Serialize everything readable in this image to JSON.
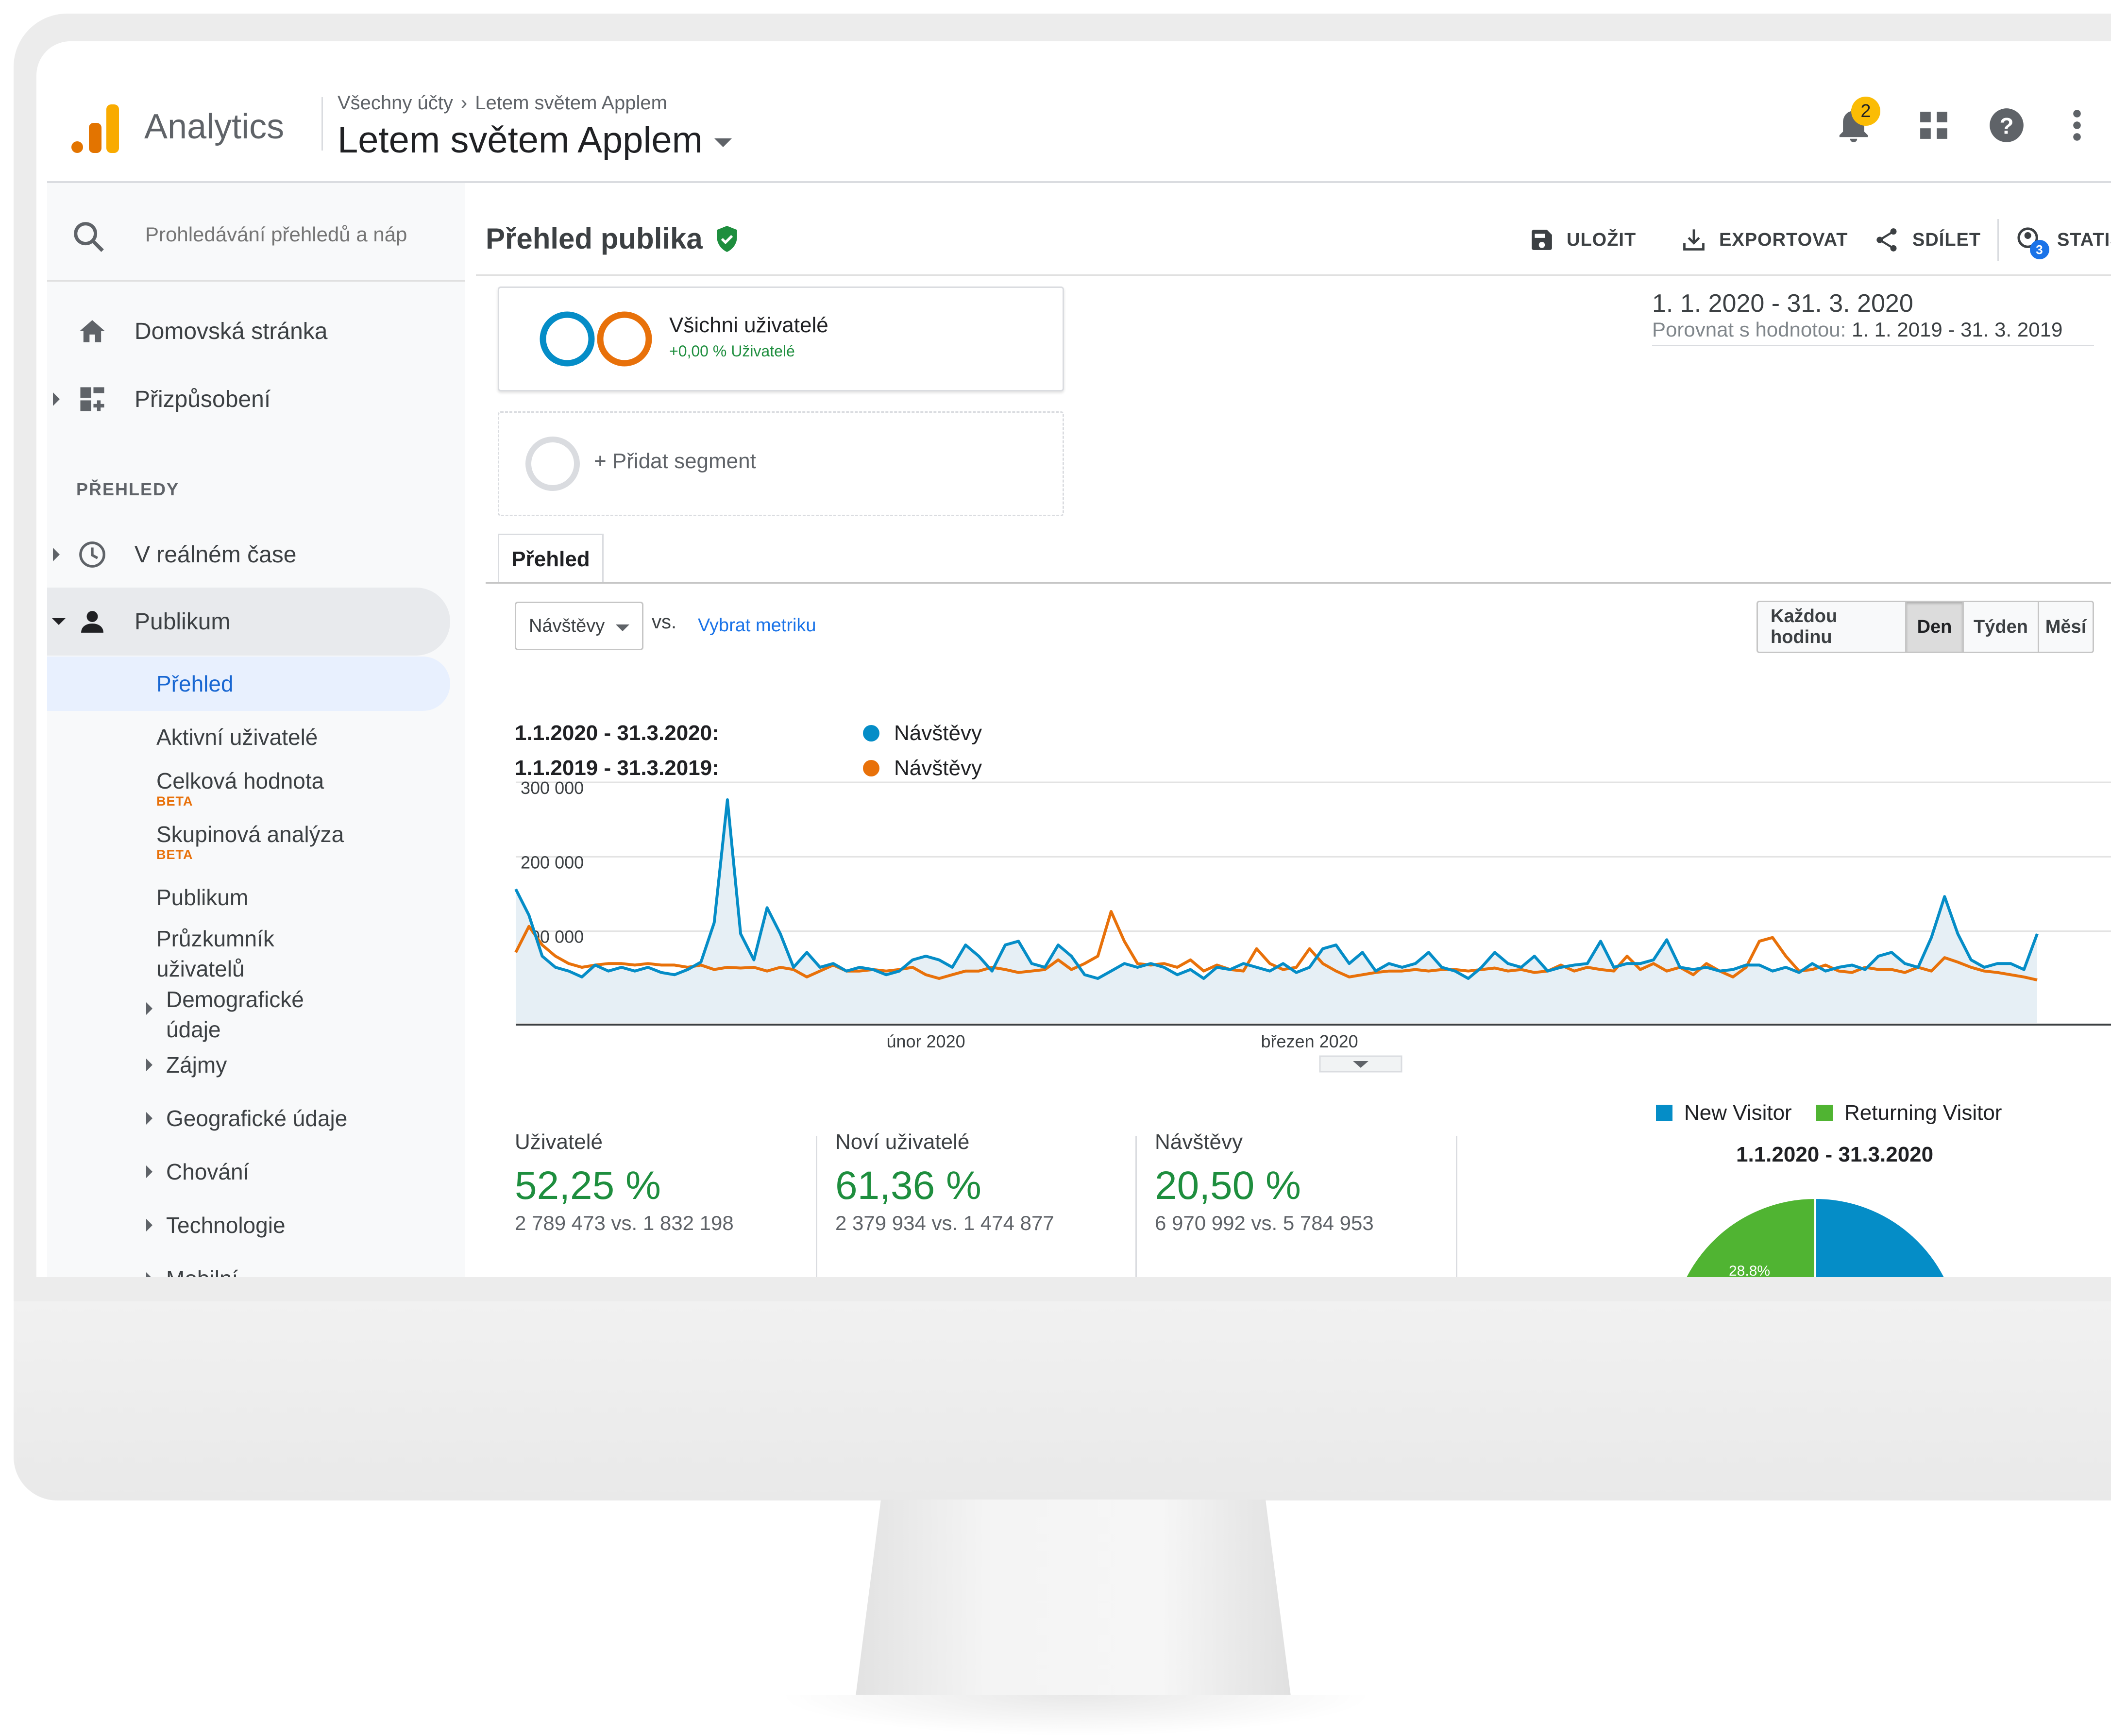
{
  "colors": {
    "current": "#058dc7",
    "previous": "#e8710a",
    "new_visitor": "#058dc7",
    "returning_visitor": "#50b432",
    "positive": "#1e8e3e",
    "link": "#1a73e8",
    "logo_dark": "#e37400",
    "logo_light": "#f9ab00"
  },
  "header": {
    "app_name": "Analytics",
    "breadcrumb": [
      "Všechny účty",
      "Letem světem Applem"
    ],
    "property": "Letem světem Applem",
    "notification_count": "2",
    "icons": [
      "bell-icon",
      "apps-grid-icon",
      "help-icon",
      "more-vert-icon"
    ]
  },
  "sidebar": {
    "search_placeholder": "Prohledávání přehledů a náp",
    "home": "Domovská stránka",
    "customization": "Přizpůsobení",
    "reports_label": "PŘEHLEDY",
    "realtime": "V reálném čase",
    "audience": "Publikum",
    "audience_items": {
      "overview": "Přehled",
      "active_users": "Aktivní uživatelé",
      "lifetime_value": "Celková hodnota",
      "cohort": "Skupinová analýza",
      "beta": "BETA",
      "audiences": "Publikum",
      "user_explorer_1": "Průzkumník",
      "user_explorer_2": "uživatelů",
      "demographics_1": "Demografické",
      "demographics_2": "údaje",
      "interests": "Zájmy",
      "geo": "Geografické údaje",
      "behavior": "Chování",
      "technology": "Technologie",
      "mobile": "Mobilní"
    }
  },
  "main": {
    "title": "Přehled publika",
    "toolbar": {
      "save": "ULOŽIT",
      "export": "EXPORTOVAT",
      "share": "SDÍLET",
      "insights": "STATIST",
      "insights_badge": "3"
    },
    "segment": {
      "name": "Všichni uživatelé",
      "sub": "+0,00 % Uživatelé",
      "add": "+ Přidat segment"
    },
    "date": {
      "range": "1. 1. 2020 - 31. 3. 2020",
      "compare_label": "Porovnat s hodnotou:",
      "compare_range": "1. 1. 2019 - 31. 3. 2019"
    },
    "tab": "Přehled",
    "metric_select": "Návštěvy",
    "vs": "vs.",
    "pick_metric": "Vybrat metriku",
    "granularity": [
      "Každou hodinu",
      "Den",
      "Týden",
      "Měsí"
    ],
    "granularity_active": "Den",
    "legend": [
      {
        "period": "1.1.2020 - 31.3.2020:",
        "metric": "Návštěvy"
      },
      {
        "period": "1.1.2019 - 31.3.2019:",
        "metric": "Návštěvy"
      }
    ]
  },
  "summary": [
    {
      "label": "Uživatelé",
      "value": "52,25 %",
      "compare": "2 789 473 vs. 1 832 198"
    },
    {
      "label": "Noví uživatelé",
      "value": "61,36 %",
      "compare": "2 379 934 vs. 1 474 877"
    },
    {
      "label": "Návštěvy",
      "value": "20,50 %",
      "compare": "6 970 992 vs. 5 784 953"
    }
  ],
  "pie": {
    "legend": [
      "New Visitor",
      "Returning Visitor"
    ],
    "title": "1.1.2020 - 31.3.2020",
    "returning_label": "28.8%"
  },
  "chart_data": [
    {
      "type": "line",
      "ylim": [
        0,
        300000
      ],
      "yticks": [
        "300 000",
        "200 000",
        "100 000"
      ],
      "x_ticks": [
        {
          "label": "únor 2020",
          "index": 31
        },
        {
          "label": "březen 2020",
          "index": 60
        }
      ],
      "series": [
        {
          "name": "Návštěvy",
          "period": "1.1.2020 - 31.3.2020",
          "values": [
            180000,
            145000,
            90000,
            75000,
            70000,
            62000,
            78000,
            70000,
            75000,
            70000,
            75000,
            68000,
            65000,
            72000,
            82000,
            135000,
            300000,
            120000,
            85000,
            155000,
            120000,
            75000,
            95000,
            75000,
            80000,
            70000,
            75000,
            72000,
            65000,
            70000,
            85000,
            90000,
            85000,
            75000,
            105000,
            90000,
            70000,
            105000,
            110000,
            80000,
            75000,
            105000,
            90000,
            65000,
            60000,
            70000,
            80000,
            75000,
            80000,
            75000,
            65000,
            72000,
            60000,
            75000,
            72000,
            80000,
            75000,
            70000,
            80000,
            68000,
            75000,
            100000,
            105000,
            80000,
            95000,
            70000,
            80000,
            75000,
            80000,
            95000,
            75000,
            70000,
            60000,
            75000,
            95000,
            80000,
            75000,
            90000,
            70000,
            75000,
            78000,
            80000,
            110000,
            75000,
            80000,
            80000,
            85000,
            112000,
            75000,
            72000,
            75000,
            70000,
            72000,
            78000,
            78000,
            70000,
            75000,
            68000,
            80000,
            70000,
            75000,
            78000,
            72000,
            90000,
            95000,
            80000,
            75000,
            115000,
            170000,
            120000,
            85000,
            75000,
            80000,
            80000,
            72000,
            120000
          ]
        },
        {
          "name": "Návštěvy",
          "period": "1.1.2019 - 31.3.2019",
          "values": [
            95000,
            130000,
            105000,
            90000,
            80000,
            75000,
            78000,
            80000,
            80000,
            78000,
            80000,
            78000,
            78000,
            75000,
            78000,
            72000,
            75000,
            74000,
            75000,
            70000,
            75000,
            72000,
            62000,
            70000,
            78000,
            70000,
            70000,
            72000,
            70000,
            72000,
            75000,
            65000,
            60000,
            65000,
            70000,
            70000,
            75000,
            72000,
            68000,
            70000,
            72000,
            85000,
            72000,
            80000,
            90000,
            150000,
            110000,
            80000,
            78000,
            80000,
            75000,
            85000,
            70000,
            78000,
            72000,
            70000,
            100000,
            80000,
            72000,
            75000,
            100000,
            80000,
            70000,
            62000,
            65000,
            68000,
            70000,
            70000,
            72000,
            70000,
            72000,
            72000,
            70000,
            72000,
            74000,
            70000,
            72000,
            68000,
            70000,
            78000,
            70000,
            75000,
            72000,
            70000,
            90000,
            72000,
            80000,
            70000,
            75000,
            65000,
            80000,
            70000,
            62000,
            75000,
            110000,
            115000,
            90000,
            70000,
            72000,
            78000,
            70000,
            68000,
            75000,
            72000,
            72000,
            68000,
            75000,
            70000,
            88000,
            82000,
            75000,
            70000,
            68000,
            65000,
            62000,
            58000
          ]
        }
      ]
    },
    {
      "type": "pie",
      "title": "1.1.2020 - 31.3.2020",
      "slices": [
        {
          "name": "New Visitor",
          "value": 71.2
        },
        {
          "name": "Returning Visitor",
          "value": 28.8
        }
      ]
    }
  ]
}
